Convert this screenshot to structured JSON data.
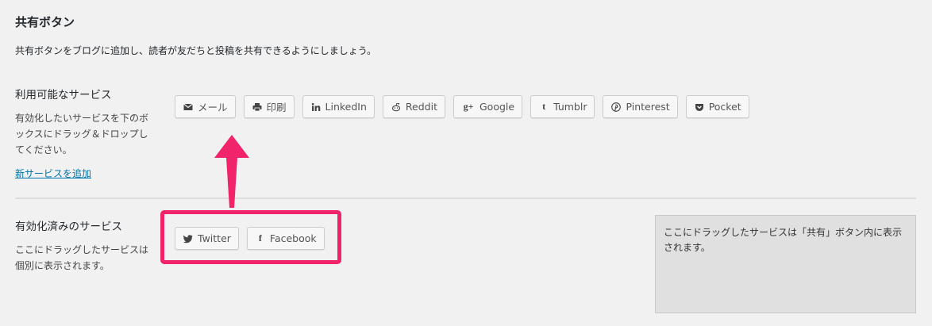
{
  "page": {
    "title": "共有ボタン",
    "description": "共有ボタンをブログに追加し、読者が友だちと投稿を共有できるようにしましょう。"
  },
  "available": {
    "label": "利用可能なサービス",
    "help": "有効化したいサービスを下のボックスにドラッグ＆ドロップしてください。",
    "add_link": "新サービスを追加",
    "services": [
      {
        "label": "メール",
        "icon": "mail-icon"
      },
      {
        "label": "印刷",
        "icon": "print-icon"
      },
      {
        "label": "LinkedIn",
        "icon": "linkedin-icon"
      },
      {
        "label": "Reddit",
        "icon": "reddit-icon"
      },
      {
        "label": "Google",
        "icon": "google-plus-icon"
      },
      {
        "label": "Tumblr",
        "icon": "tumblr-icon"
      },
      {
        "label": "Pinterest",
        "icon": "pinterest-icon"
      },
      {
        "label": "Pocket",
        "icon": "pocket-icon"
      }
    ]
  },
  "enabled": {
    "label": "有効化済みのサービス",
    "help": "ここにドラッグしたサービスは個別に表示されます。",
    "services": [
      {
        "label": "Twitter",
        "icon": "twitter-icon"
      },
      {
        "label": "Facebook",
        "icon": "facebook-icon"
      }
    ]
  },
  "share_box": {
    "text": "ここにドラッグしたサービスは「共有」ボタン内に表示されます。"
  },
  "colors": {
    "highlight": "#f0236b",
    "link": "#0073aa",
    "background": "#f1f1f1"
  }
}
